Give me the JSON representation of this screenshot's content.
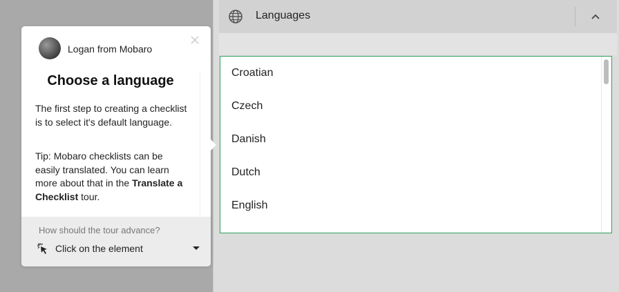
{
  "panel": {
    "section_title": "Languages",
    "languages": [
      "Croatian",
      "Czech",
      "Danish",
      "Dutch",
      "English"
    ]
  },
  "tour": {
    "author": "Logan from Mobaro",
    "title": "Choose a language",
    "para1": "The first step to creating a checklist is to select it's default language.",
    "para2_prefix": "Tip: Mobaro checklists can be easily translated. You can learn more about that in the ",
    "para2_bold": "Translate a Checklist",
    "para2_suffix": " tour.",
    "advance_question": "How should the tour advance?",
    "advance_value": "Click on the element"
  },
  "colors": {
    "list_border": "#2ca05a",
    "backdrop": "#a9a9a9"
  },
  "icons": [
    "globe-icon",
    "chevron-up-icon",
    "close-icon",
    "click-pointer-icon",
    "caret-down-icon"
  ]
}
